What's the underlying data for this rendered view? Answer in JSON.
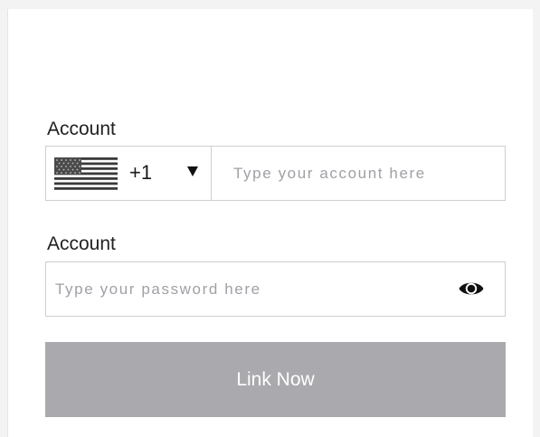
{
  "form": {
    "account_label": "Account",
    "country_code": "+1",
    "country_flag_icon": "us-flag-icon",
    "dropdown_icon": "caret-down-icon",
    "account_placeholder": "Type your account here",
    "password_label": "Account",
    "password_placeholder": "Type your password here",
    "visibility_icon": "eye-icon",
    "submit_label": "Link Now",
    "submit_color": "#aaa9ae"
  }
}
